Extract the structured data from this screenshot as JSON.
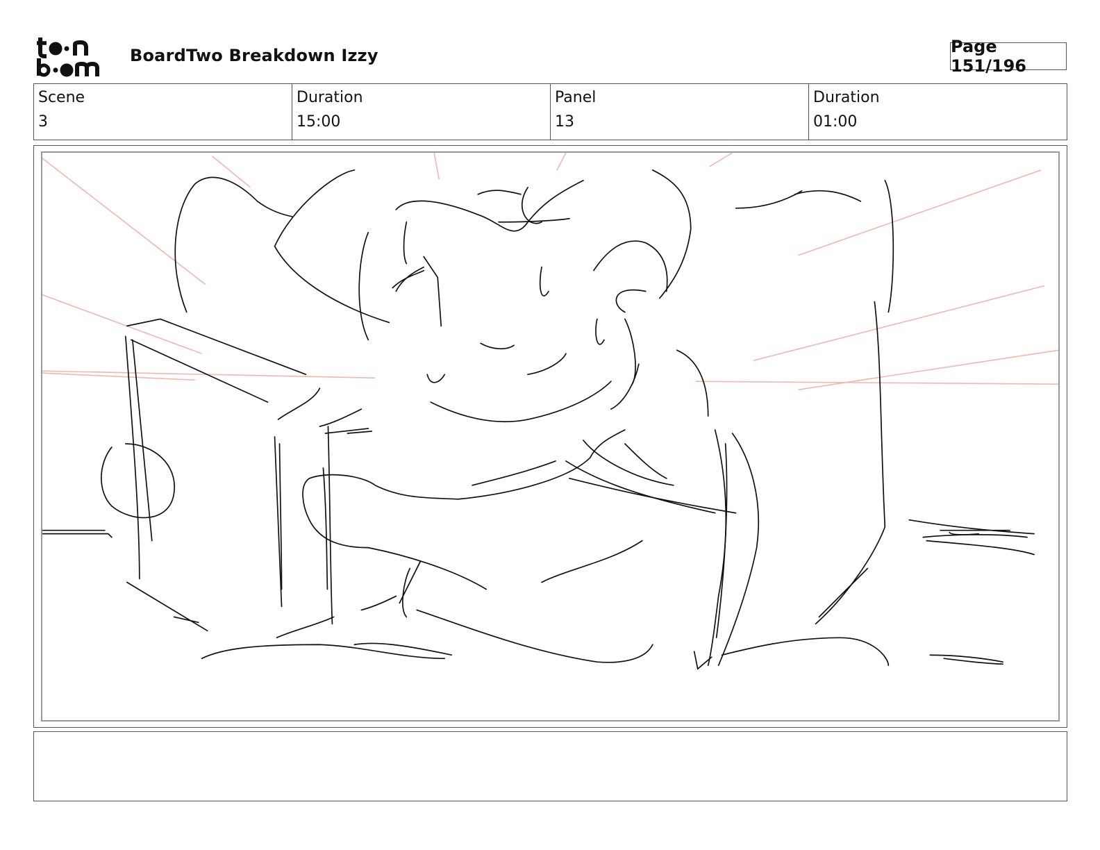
{
  "header": {
    "logo_text": "toon boom",
    "title": "BoardTwo Breakdown Izzy",
    "page": "Page 151/196"
  },
  "info": {
    "scene_label": "Scene",
    "scene_value": "3",
    "scene_duration_label": "Duration",
    "scene_duration_value": "15:00",
    "panel_label": "Panel",
    "panel_value": "13",
    "panel_duration_label": "Duration",
    "panel_duration_value": "01:00"
  },
  "notes": {
    "text": ""
  },
  "colors": {
    "sketch_line": "#111111",
    "construction_line": "#f0b7ad",
    "frame_border": "#555555",
    "safe_area_border": "#999999"
  }
}
